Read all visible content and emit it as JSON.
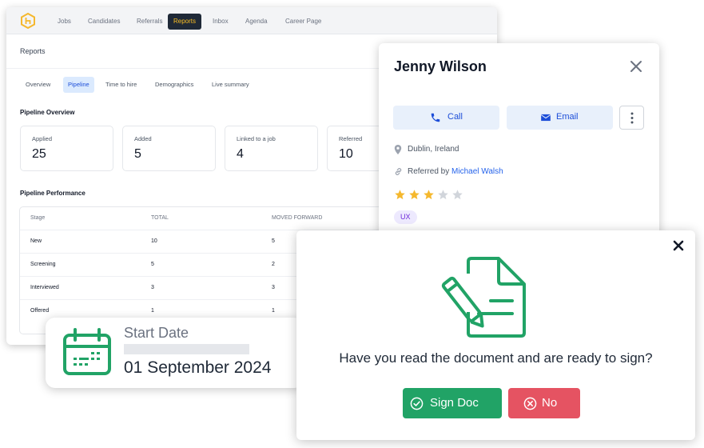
{
  "dashboard": {
    "nav": [
      {
        "label": "Jobs",
        "active": false
      },
      {
        "label": "Candidates",
        "active": false
      },
      {
        "label": "Referrals",
        "active": false
      },
      {
        "label": "Reports",
        "active": true
      },
      {
        "label": "Inbox",
        "active": false
      },
      {
        "label": "Agenda",
        "active": false
      },
      {
        "label": "Career Page",
        "active": false
      }
    ],
    "page_title": "Reports",
    "subtabs": [
      {
        "label": "Overview",
        "active": false
      },
      {
        "label": "Pipeline",
        "active": true
      },
      {
        "label": "Time to hire",
        "active": false
      },
      {
        "label": "Demographics",
        "active": false
      },
      {
        "label": "Live summary",
        "active": false
      }
    ],
    "overview_title": "Pipeline Overview",
    "stats": [
      {
        "label": "Applied",
        "value": "25"
      },
      {
        "label": "Added",
        "value": "5"
      },
      {
        "label": "Linked to a job",
        "value": "4"
      },
      {
        "label": "Referred",
        "value": "10"
      }
    ],
    "performance_title": "Pipeline Performance",
    "table": {
      "columns": [
        "Stage",
        "TOTAL",
        "MOVED FORWARD"
      ],
      "rows": [
        [
          "New",
          "10",
          "5"
        ],
        [
          "Screening",
          "5",
          "2"
        ],
        [
          "Interviewed",
          "3",
          "3"
        ],
        [
          "Offered",
          "1",
          "1"
        ]
      ]
    }
  },
  "candidate": {
    "name": "Jenny Wilson",
    "call_label": "Call",
    "email_label": "Email",
    "location": "Dublin, Ireland",
    "referred_prefix": "Referred by",
    "referred_by": "Michael Walsh",
    "rating": 3,
    "rating_max": 5,
    "tag": "UX"
  },
  "start_date": {
    "label": "Start Date",
    "value": "01 September 2024"
  },
  "sign_modal": {
    "question": "Have you read the document and are ready to sign?",
    "sign_label": "Sign Doc",
    "no_label": "No"
  },
  "colors": {
    "green": "#21a366",
    "red": "#e55362",
    "blue": "#1d4ed8",
    "star_filled": "#f5b82e",
    "star_empty": "#d1d5db"
  }
}
